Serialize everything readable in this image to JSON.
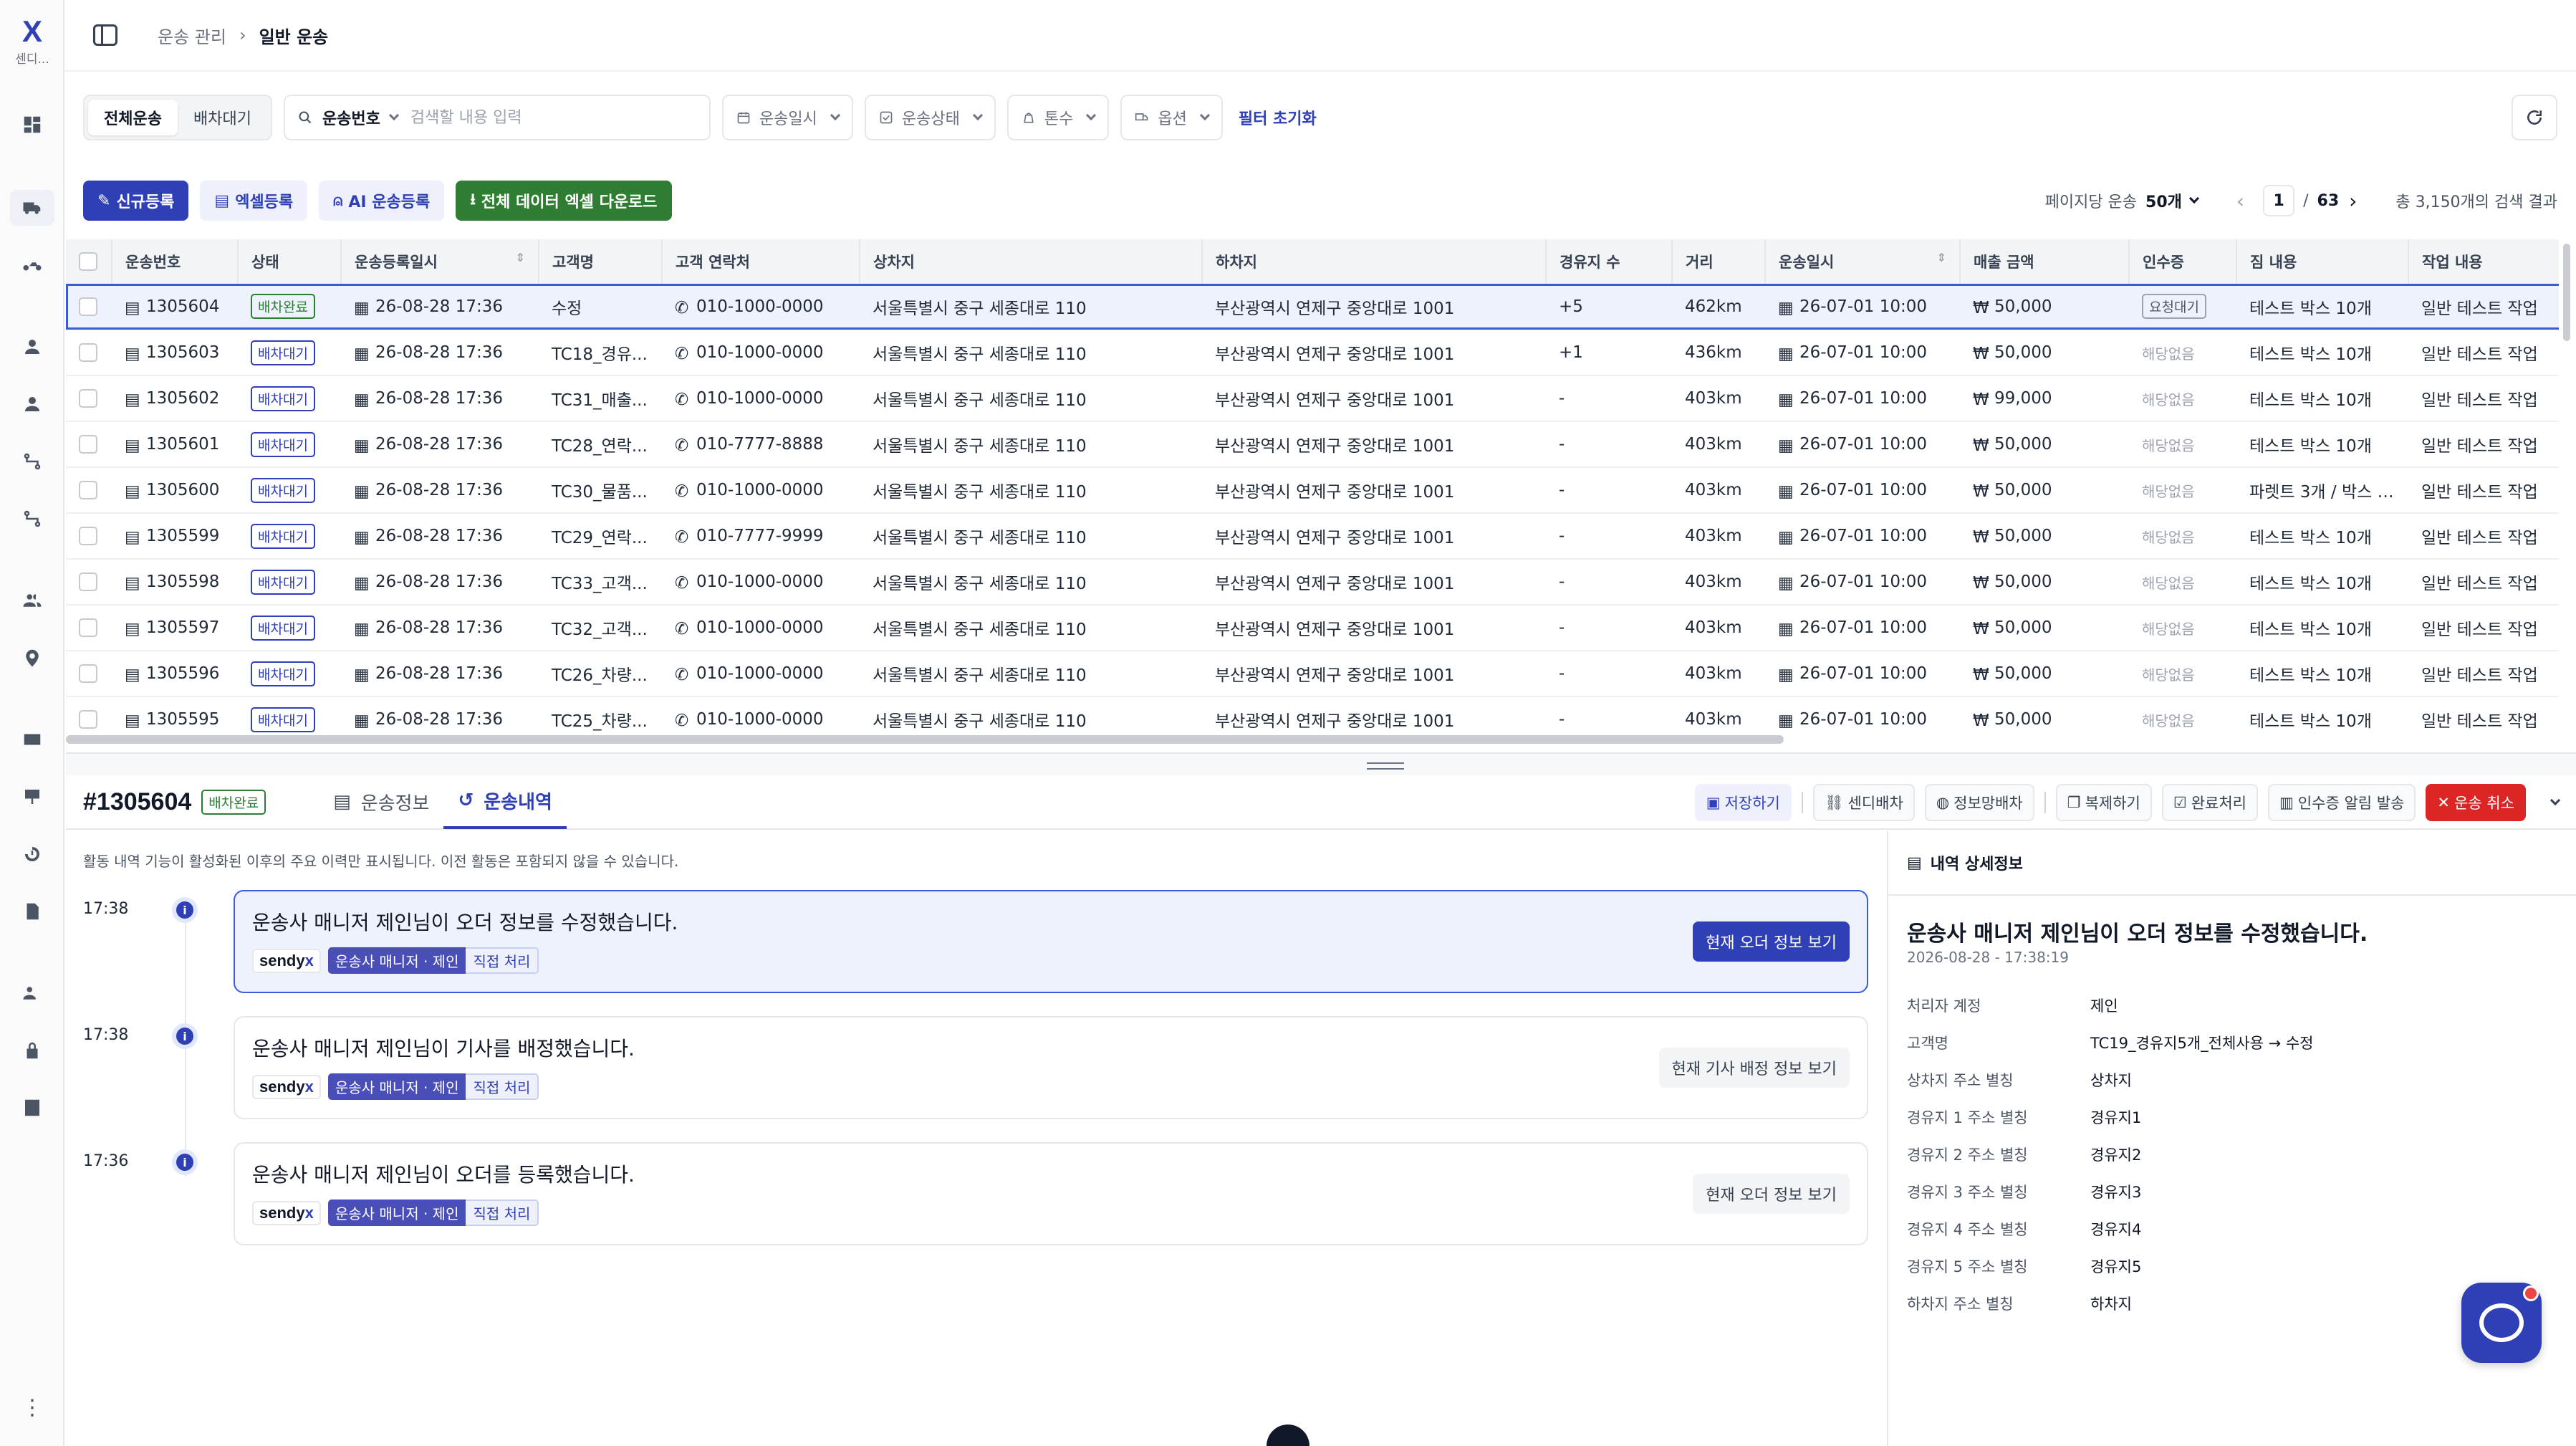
{
  "app": {
    "logo": "X",
    "logo_sub": "센디..."
  },
  "breadcrumb": {
    "parent": "운송 관리",
    "current": "일반 운송"
  },
  "filters": {
    "segments": [
      "전체운송",
      "배차대기"
    ],
    "search_field": "운송번호",
    "search_placeholder": "검색할 내용 입력",
    "dropdowns": [
      "운송일시",
      "운송상태",
      "톤수",
      "옵션"
    ],
    "reset": "필터 초기화"
  },
  "actions": {
    "new": "신규등록",
    "excel": "엑셀등록",
    "ai": "AI 운송등록",
    "download": "전체 데이터 엑셀 다운로드",
    "per_page_label": "페이지당 운송",
    "per_page": "50개",
    "page": "1",
    "of": "/",
    "pages": "63",
    "total": "총 3,150개의 검색 결과"
  },
  "table": {
    "columns": [
      "운송번호",
      "상태",
      "운송등록일시",
      "고객명",
      "고객 연락처",
      "상차지",
      "하차지",
      "경유지 수",
      "거리",
      "운송일시",
      "매출 금액",
      "인수증",
      "짐 내용",
      "작업 내용"
    ],
    "rows": [
      {
        "id": "1305604",
        "status": "배차완료",
        "reg": "26-08-28 17:36",
        "customer": "수정",
        "phone": "010-1000-0000",
        "pickup": "서울특별시 중구 세종대로 110",
        "dropoff": "부산광역시 연제구 중앙대로 1001",
        "stops": "+5",
        "dist": "462km",
        "date": "26-07-01 10:00",
        "amount": "50,000",
        "receipt": "요청대기",
        "cargo": "테스트 박스 10개",
        "work": "일반 테스트 작업"
      },
      {
        "id": "1305603",
        "status": "배차대기",
        "reg": "26-08-28 17:36",
        "customer": "TC18_경유...",
        "phone": "010-1000-0000",
        "pickup": "서울특별시 중구 세종대로 110",
        "dropoff": "부산광역시 연제구 중앙대로 1001",
        "stops": "+1",
        "dist": "436km",
        "date": "26-07-01 10:00",
        "amount": "50,000",
        "receipt": "해당없음",
        "cargo": "테스트 박스 10개",
        "work": "일반 테스트 작업"
      },
      {
        "id": "1305602",
        "status": "배차대기",
        "reg": "26-08-28 17:36",
        "customer": "TC31_매출...",
        "phone": "010-1000-0000",
        "pickup": "서울특별시 중구 세종대로 110",
        "dropoff": "부산광역시 연제구 중앙대로 1001",
        "stops": "-",
        "dist": "403km",
        "date": "26-07-01 10:00",
        "amount": "99,000",
        "receipt": "해당없음",
        "cargo": "테스트 박스 10개",
        "work": "일반 테스트 작업"
      },
      {
        "id": "1305601",
        "status": "배차대기",
        "reg": "26-08-28 17:36",
        "customer": "TC28_연락...",
        "phone": "010-7777-8888",
        "pickup": "서울특별시 중구 세종대로 110",
        "dropoff": "부산광역시 연제구 중앙대로 1001",
        "stops": "-",
        "dist": "403km",
        "date": "26-07-01 10:00",
        "amount": "50,000",
        "receipt": "해당없음",
        "cargo": "테스트 박스 10개",
        "work": "일반 테스트 작업"
      },
      {
        "id": "1305600",
        "status": "배차대기",
        "reg": "26-08-28 17:36",
        "customer": "TC30_물품...",
        "phone": "010-1000-0000",
        "pickup": "서울특별시 중구 세종대로 110",
        "dropoff": "부산광역시 연제구 중앙대로 1001",
        "stops": "-",
        "dist": "403km",
        "date": "26-07-01 10:00",
        "amount": "50,000",
        "receipt": "해당없음",
        "cargo": "파렛트 3개 / 박스 2...",
        "work": "일반 테스트 작업"
      },
      {
        "id": "1305599",
        "status": "배차대기",
        "reg": "26-08-28 17:36",
        "customer": "TC29_연락...",
        "phone": "010-7777-9999",
        "pickup": "서울특별시 중구 세종대로 110",
        "dropoff": "부산광역시 연제구 중앙대로 1001",
        "stops": "-",
        "dist": "403km",
        "date": "26-07-01 10:00",
        "amount": "50,000",
        "receipt": "해당없음",
        "cargo": "테스트 박스 10개",
        "work": "일반 테스트 작업"
      },
      {
        "id": "1305598",
        "status": "배차대기",
        "reg": "26-08-28 17:36",
        "customer": "TC33_고객...",
        "phone": "010-1000-0000",
        "pickup": "서울특별시 중구 세종대로 110",
        "dropoff": "부산광역시 연제구 중앙대로 1001",
        "stops": "-",
        "dist": "403km",
        "date": "26-07-01 10:00",
        "amount": "50,000",
        "receipt": "해당없음",
        "cargo": "테스트 박스 10개",
        "work": "일반 테스트 작업"
      },
      {
        "id": "1305597",
        "status": "배차대기",
        "reg": "26-08-28 17:36",
        "customer": "TC32_고객...",
        "phone": "010-1000-0000",
        "pickup": "서울특별시 중구 세종대로 110",
        "dropoff": "부산광역시 연제구 중앙대로 1001",
        "stops": "-",
        "dist": "403km",
        "date": "26-07-01 10:00",
        "amount": "50,000",
        "receipt": "해당없음",
        "cargo": "테스트 박스 10개",
        "work": "일반 테스트 작업"
      },
      {
        "id": "1305596",
        "status": "배차대기",
        "reg": "26-08-28 17:36",
        "customer": "TC26_차량...",
        "phone": "010-1000-0000",
        "pickup": "서울특별시 중구 세종대로 110",
        "dropoff": "부산광역시 연제구 중앙대로 1001",
        "stops": "-",
        "dist": "403km",
        "date": "26-07-01 10:00",
        "amount": "50,000",
        "receipt": "해당없음",
        "cargo": "테스트 박스 10개",
        "work": "일반 테스트 작업"
      },
      {
        "id": "1305595",
        "status": "배차대기",
        "reg": "26-08-28 17:36",
        "customer": "TC25_차량...",
        "phone": "010-1000-0000",
        "pickup": "서울특별시 중구 세종대로 110",
        "dropoff": "부산광역시 연제구 중앙대로 1001",
        "stops": "-",
        "dist": "403km",
        "date": "26-07-01 10:00",
        "amount": "50,000",
        "receipt": "해당없음",
        "cargo": "테스트 박스 10개",
        "work": "일반 테스트 작업"
      }
    ]
  },
  "detail": {
    "order_no": "#1305604",
    "status": "배차완료",
    "tabs": [
      "운송정보",
      "운송내역"
    ],
    "buttons": [
      "저장하기",
      "센디배차",
      "정보망배차",
      "복제하기",
      "완료처리",
      "인수증 알림 발송",
      "운송 취소"
    ],
    "note": "활동 내역 기능이 활성화된 이후의 주요 이력만 표시됩니다. 이전 활동은 포함되지 않을 수 있습니다."
  },
  "activity": [
    {
      "time": "17:38",
      "msg": "운송사 매니저 제인님이 오더 정보를 수정했습니다.",
      "btn": "현재 오더 정보 보기"
    },
    {
      "time": "17:38",
      "msg": "운송사 매니저 제인님이 기사를 배정했습니다.",
      "btn": "현재 기사 배정 정보 보기"
    },
    {
      "time": "17:36",
      "msg": "운송사 매니저 제인님이 오더를 등록했습니다.",
      "btn": "현재 오더 정보 보기"
    }
  ],
  "activity_tags": {
    "brand_a": "sendy",
    "brand_b": "x",
    "manager": "운송사 매니저 · 제인",
    "direct": "직접 처리"
  },
  "panel": {
    "header": "내역 상세정보",
    "title": "운송사 매니저 제인님이 오더 정보를 수정했습니다.",
    "date": "2026-08-28 - 17:38:19",
    "rows": [
      {
        "k": "처리자 계정",
        "v": "제인"
      },
      {
        "k": "고객명",
        "v": "TC19_경유지5개_전체사용 → 수정"
      },
      {
        "k": "상차지 주소 별칭",
        "v": "상차지"
      },
      {
        "k": "경유지 1 주소 별칭",
        "v": "경유지1"
      },
      {
        "k": "경유지 2 주소 별칭",
        "v": "경유지2"
      },
      {
        "k": "경유지 3 주소 별칭",
        "v": "경유지3"
      },
      {
        "k": "경유지 4 주소 별칭",
        "v": "경유지4"
      },
      {
        "k": "경유지 5 주소 별칭",
        "v": "경유지5"
      },
      {
        "k": "하차지 주소 별칭",
        "v": "하차지"
      }
    ]
  },
  "colors": {
    "accent": "#2f3fb6",
    "success": "#2e7d32",
    "danger": "#dc2626"
  }
}
